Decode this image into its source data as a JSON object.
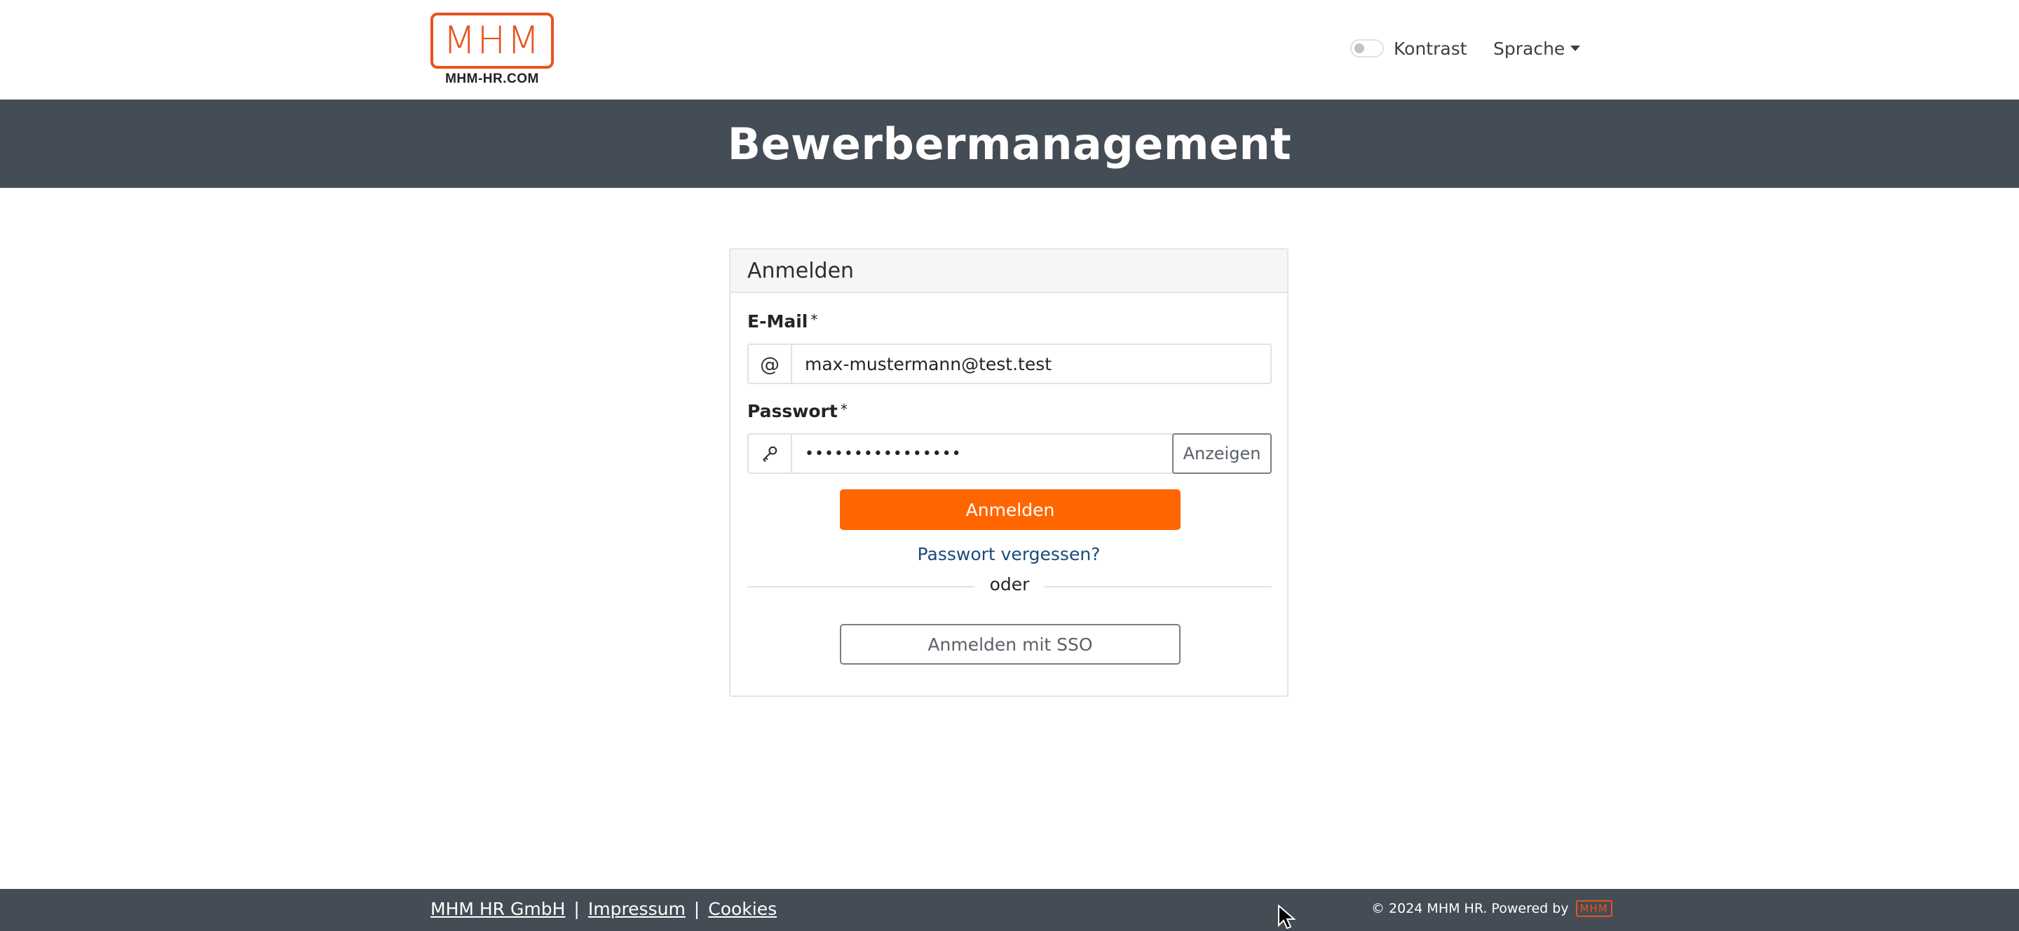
{
  "brand": {
    "logo_text": "MHM",
    "logo_caption": "MHM-HR.COM",
    "accent_color": "#ff6600",
    "logo_color": "#e8531d",
    "banner_color": "#444c55"
  },
  "header": {
    "contrast_label": "Kontrast",
    "contrast_enabled": false,
    "language_label": "Sprache"
  },
  "banner": {
    "title": "Bewerbermanagement"
  },
  "login": {
    "title": "Anmelden",
    "email": {
      "label": "E-Mail",
      "required_marker": "*",
      "icon": "at-icon",
      "value": "max-mustermann@test.test"
    },
    "password": {
      "label": "Passwort",
      "required_marker": "*",
      "icon": "key-icon",
      "value_masked": "••••••••••••••••",
      "show_label": "Anzeigen"
    },
    "submit_label": "Anmelden",
    "forgot_label": "Passwort vergessen?",
    "divider_label": "oder",
    "sso_label": "Anmelden mit SSO"
  },
  "footer": {
    "links": [
      "MHM HR GmbH",
      "Impressum",
      "Cookies"
    ],
    "separator": "|",
    "copyright": "© 2024 MHM HR. Powered by",
    "powered_logo": "MHM"
  }
}
